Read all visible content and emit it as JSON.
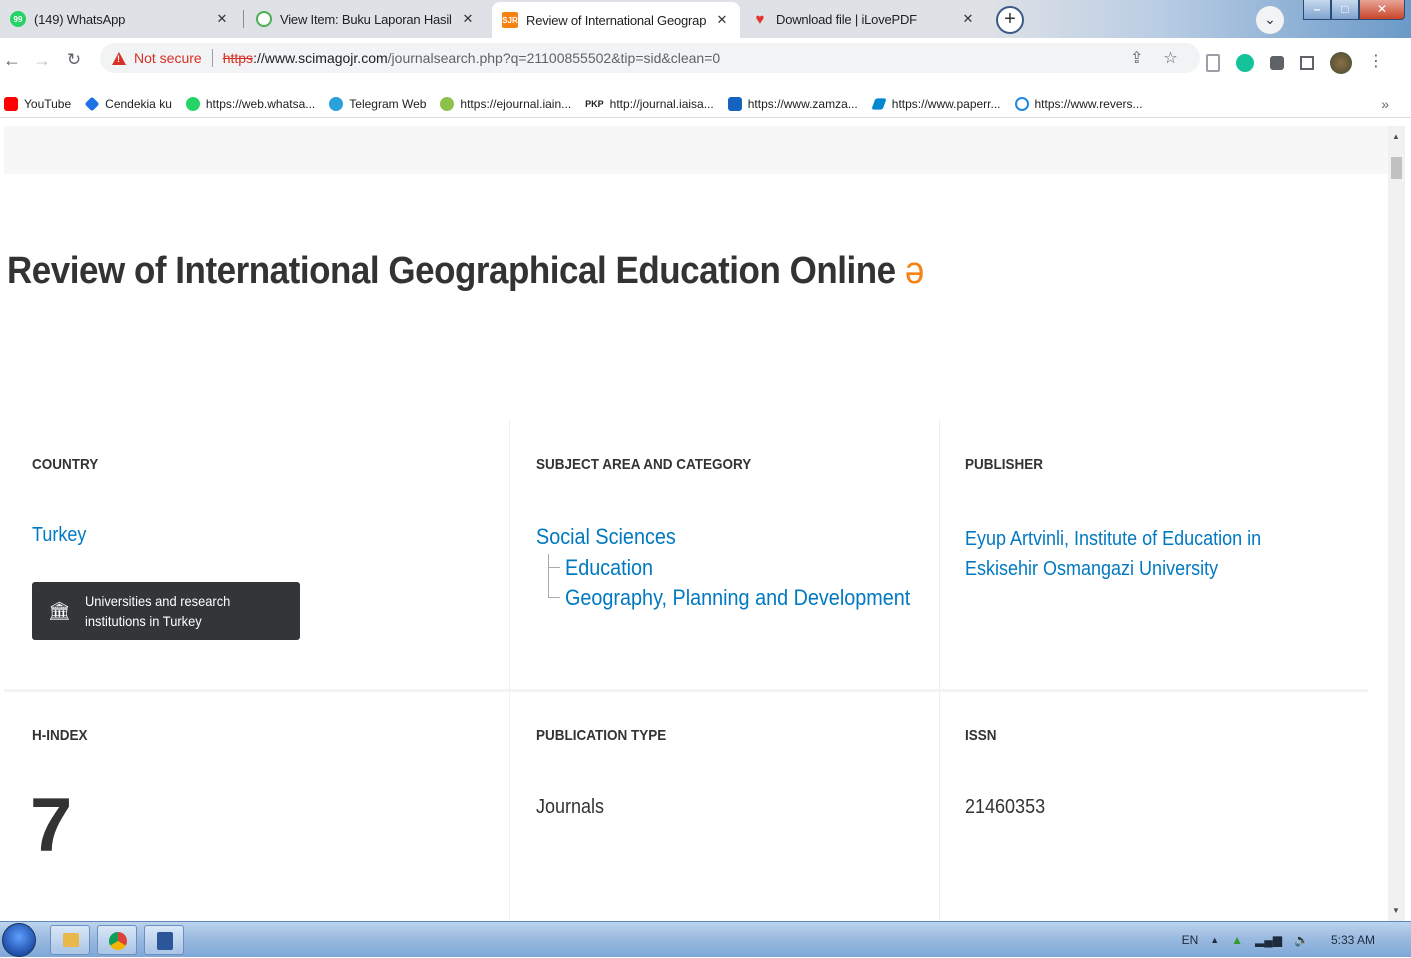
{
  "browser": {
    "tabs": [
      {
        "title": "(149) WhatsApp",
        "favicon": "whatsapp-icon",
        "color": "#25d366",
        "active": false
      },
      {
        "title": "View Item: Buku Laporan Hasil Pe",
        "favicon": "repository-icon",
        "color": "#4caf50",
        "active": false
      },
      {
        "title": "Review of International Geograp",
        "favicon": "sjr-icon",
        "color": "#f68212",
        "active": true
      },
      {
        "title": "Download file | iLovePDF",
        "favicon": "heart-icon",
        "color": "#e5322d",
        "active": false
      }
    ],
    "new_tab_label": "+",
    "close_glyph": "✕",
    "address": {
      "security_label": "Not secure",
      "scheme": "https",
      "host": "://www.scimagojr.com",
      "path": "/journalsearch.php?q=21100855502&tip=sid&clean=0"
    },
    "bookmarks": [
      {
        "label": "YouTube",
        "icon": "youtube-icon",
        "color": "#ff0000"
      },
      {
        "label": "Cendekia ku",
        "icon": "cendekia-icon",
        "color": "#1a73e8"
      },
      {
        "label": "https://web.whatsa...",
        "icon": "whatsapp-icon",
        "color": "#25d366"
      },
      {
        "label": "Telegram Web",
        "icon": "telegram-icon",
        "color": "#2aa1da"
      },
      {
        "label": "https://ejournal.iain...",
        "icon": "ejournal-icon",
        "color": "#8bc34a"
      },
      {
        "label": "http://journal.iaisa...",
        "icon": "pkp-icon",
        "color": "#333333",
        "prefix": "PKP"
      },
      {
        "label": "https://www.zamza...",
        "icon": "zamzar-icon",
        "color": "#1565c0"
      },
      {
        "label": "https://www.paperr...",
        "icon": "paperrater-icon",
        "color": "#0288d1"
      },
      {
        "label": "https://www.revers...",
        "icon": "reverso-icon",
        "color": "#1e88e5"
      }
    ],
    "more_bookmarks": "»"
  },
  "journal": {
    "title": "Review of International Geographical Education Online",
    "open_access_glyph": "ə",
    "country_label": "COUNTRY",
    "country": "Turkey",
    "institutions_button": "Universities and research institutions in Turkey",
    "subject_label": "SUBJECT AREA AND CATEGORY",
    "subject_area": "Social Sciences",
    "categories": [
      "Education",
      "Geography, Planning and Development"
    ],
    "publisher_label": "PUBLISHER",
    "publisher": "Eyup Artvinli, Institute of Education in Eskisehir Osmangazi University",
    "hindex_label": "H-INDEX",
    "hindex": "7",
    "pubtype_label": "PUBLICATION TYPE",
    "pubtype": "Journals",
    "issn_label": "ISSN",
    "issn": "21460353"
  },
  "taskbar": {
    "language": "EN",
    "time": "5:33 AM"
  }
}
